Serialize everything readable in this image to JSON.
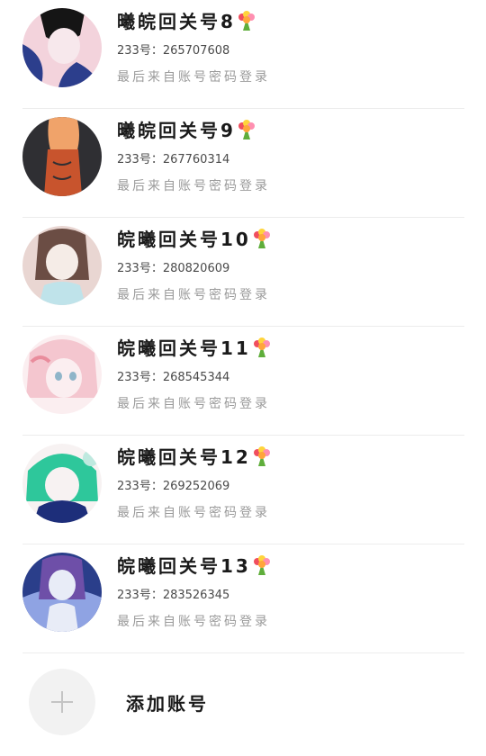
{
  "accounts": [
    {
      "name": "曦皖回关号8",
      "id_text": "233号：265707608",
      "hint": "最后来自账号密码登录",
      "avatar_colors": [
        "#f3d3dc",
        "#2c3e8c",
        "#151515",
        "#f7e8ec"
      ]
    },
    {
      "name": "曦皖回关号9",
      "id_text": "233号：267760314",
      "hint": "最后来自账号密码登录",
      "avatar_colors": [
        "#2f2f33",
        "#c8542d",
        "#f0a36a",
        "#e3e3e3"
      ]
    },
    {
      "name": "皖曦回关号10",
      "id_text": "233号：280820609",
      "hint": "最后来自账号密码登录",
      "avatar_colors": [
        "#e9d6d2",
        "#6b4d44",
        "#bfe3ea",
        "#f5ece7"
      ]
    },
    {
      "name": "皖曦回关号11",
      "id_text": "233号：268545344",
      "hint": "最后来自账号密码登录",
      "avatar_colors": [
        "#f4c6cf",
        "#e98c9c",
        "#8fb5c9",
        "#fbeef0"
      ]
    },
    {
      "name": "皖曦回关号12",
      "id_text": "233号：269252069",
      "hint": "最后来自账号密码登录",
      "avatar_colors": [
        "#bfe9df",
        "#2ec79b",
        "#1d2e7a",
        "#f7f2f2"
      ]
    },
    {
      "name": "皖曦回关号13",
      "id_text": "233号：283526345",
      "hint": "最后来自账号密码登录",
      "avatar_colors": [
        "#2a3e8a",
        "#8fa3e3",
        "#6e4fa8",
        "#e8ecf7"
      ]
    }
  ],
  "add_account": {
    "label": "添加账号"
  },
  "icons": {
    "name_suffix": "bouquet-icon",
    "add": "plus-icon"
  },
  "colors": {
    "divider": "#ececec",
    "name_text": "#1a1a1a",
    "hint_text": "#9a9a9a",
    "add_circle": "#f2f2f2",
    "plus": "#c4c4c4"
  }
}
